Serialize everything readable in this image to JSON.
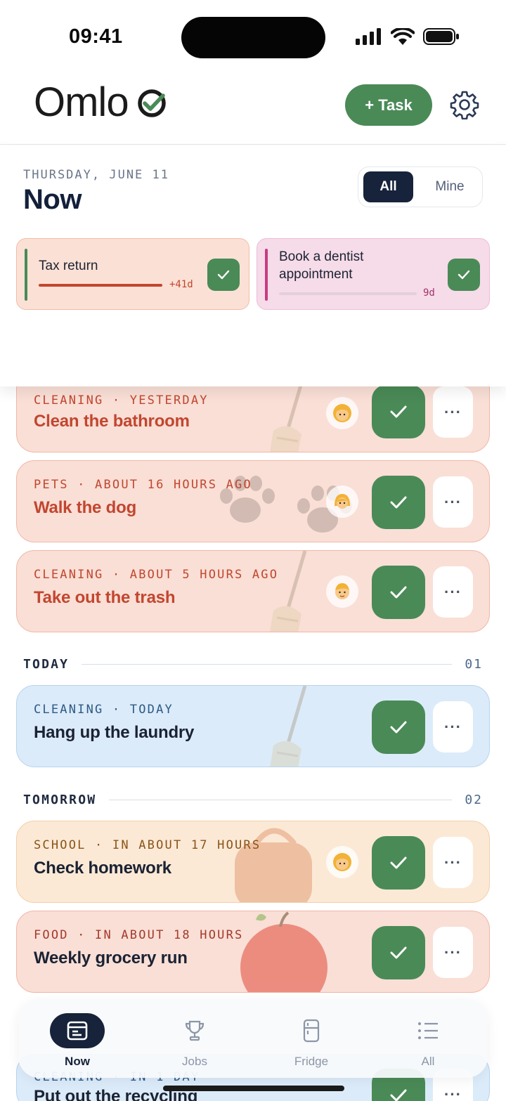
{
  "status": {
    "time": "09:41"
  },
  "header": {
    "logo_text": "Omloo",
    "add_task_label": "+ Task"
  },
  "now": {
    "date": "THURSDAY, JUNE 11",
    "title": "Now",
    "filter": {
      "all": "All",
      "mine": "Mine",
      "selected": "All"
    }
  },
  "pinned": [
    {
      "title": "Tax return",
      "days": "+41d",
      "progress": 1.0,
      "color": "#c2462f"
    },
    {
      "title": "Book a dentist appointment",
      "title_line1": "Book a dentist",
      "title_line2": "appointment",
      "days": "9d",
      "progress": 0.0,
      "color": "#c93b82"
    }
  ],
  "overdue": [
    {
      "category": "CLEANING · YESTERDAY",
      "title": "Clean the bathroom",
      "avatar": "woman-blonde"
    },
    {
      "category": "PETS · ABOUT 16 HOURS AGO",
      "title": "Walk the dog",
      "avatar": "person-blonde"
    },
    {
      "category": "CLEANING · ABOUT 5 HOURS AGO",
      "title": "Take out the trash",
      "avatar": "man-blonde"
    }
  ],
  "sections": [
    {
      "label": "TODAY",
      "count": "01"
    },
    {
      "label": "TOMORROW",
      "count": "02"
    }
  ],
  "today": [
    {
      "category": "CLEANING · TODAY",
      "title": "Hang up the laundry"
    }
  ],
  "tomorrow": [
    {
      "category": "SCHOOL · IN ABOUT 17 HOURS",
      "title": "Check homework",
      "avatar": "woman-blonde"
    },
    {
      "category": "FOOD · IN ABOUT 18 HOURS",
      "title": "Weekly grocery run"
    }
  ],
  "peek": {
    "category": "CLEANING · IN 1 DAY",
    "title": "Put out the recycling"
  },
  "more_label": "···",
  "tabs": [
    {
      "label": "Now",
      "icon": "calendar-icon",
      "active": true
    },
    {
      "label": "Jobs",
      "icon": "trophy-icon",
      "active": false
    },
    {
      "label": "Fridge",
      "icon": "fridge-icon",
      "active": false
    },
    {
      "label": "All",
      "icon": "list-icon",
      "active": false
    }
  ]
}
